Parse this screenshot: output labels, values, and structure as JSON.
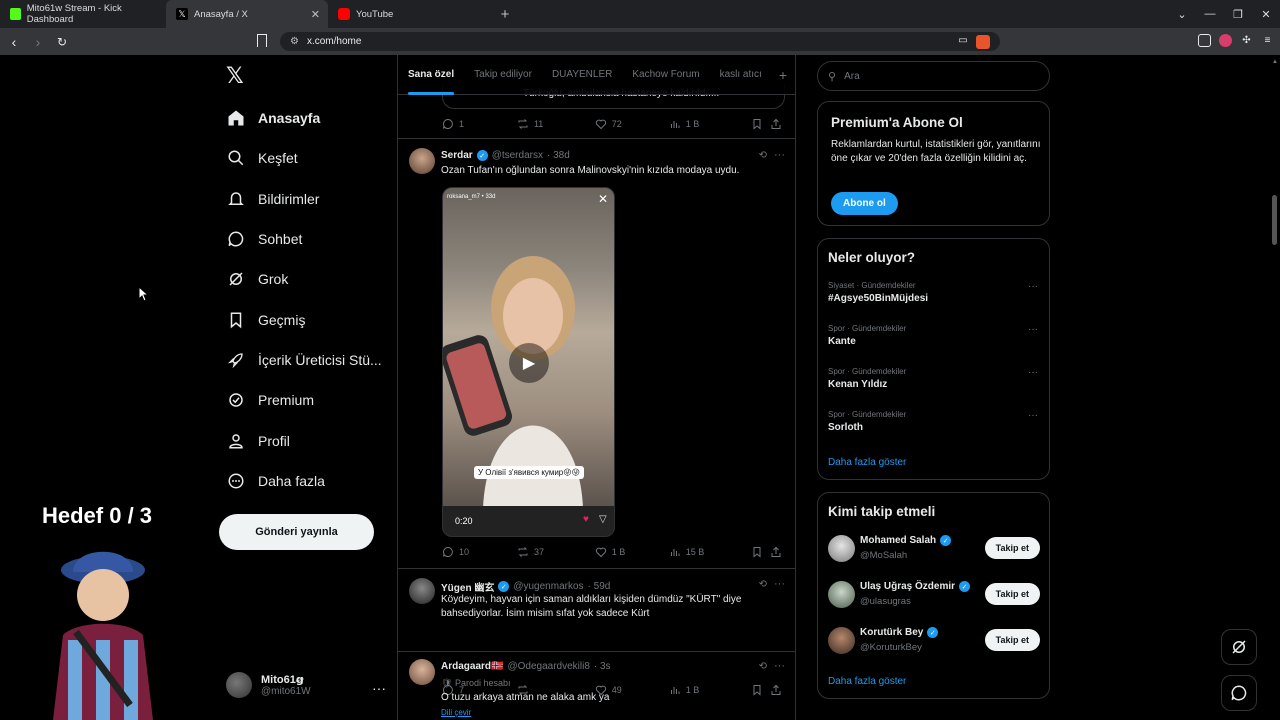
{
  "browser": {
    "tabs": [
      {
        "label": "Mito61w Stream - Kick Dashboard",
        "color": "#53fc18"
      },
      {
        "label": "Anasayfa / X",
        "color": "#ffffff"
      },
      {
        "label": "YouTube",
        "color": "#ff0000"
      }
    ],
    "url": "x.com/home"
  },
  "nav": {
    "items": [
      {
        "label": "Anasayfa",
        "icon": "home-icon"
      },
      {
        "label": "Keşfet",
        "icon": "search-icon"
      },
      {
        "label": "Bildirimler",
        "icon": "bell-icon"
      },
      {
        "label": "Sohbet",
        "icon": "chat-icon"
      },
      {
        "label": "Grok",
        "icon": "grok-icon"
      },
      {
        "label": "Geçmiş",
        "icon": "bookmark-icon"
      },
      {
        "label": "İçerik Üreticisi Stü...",
        "icon": "rocket-icon"
      },
      {
        "label": "Premium",
        "icon": "premium-icon"
      },
      {
        "label": "Profil",
        "icon": "profile-icon"
      },
      {
        "label": "Daha fazla",
        "icon": "more-icon"
      }
    ],
    "post_button": "Gönderi yayınla",
    "account": {
      "name": "Mito61ꞡ",
      "handle": "@mito61W"
    }
  },
  "overlay": {
    "goal": "Hedef 0 / 3"
  },
  "feed": {
    "tabs": [
      "Sana özel",
      "Takip ediliyor",
      "DUAYENLER",
      "Kachow Forum",
      "kaslı atıcı"
    ],
    "snippet_text": "Türkoğlu, ambulansla hastaneye kaldırıldı....",
    "top_actions": {
      "replies": "1",
      "reposts": "11",
      "likes": "72",
      "views": "1 B"
    },
    "posts": [
      {
        "name": "Serdar",
        "handle": "@tserdarsx",
        "time": "· 38d",
        "text": "Ozan Tufan'ın oğlundan sonra Malinovskyi'nin kızıda modaya uydu.",
        "video_duration": "0:20",
        "video_caption": "У Олівії з'явився кумир😜😜",
        "video_user": "roksana_m7 • 33d",
        "actions": {
          "replies": "10",
          "reposts": "37",
          "likes": "1 B",
          "views": "15 B"
        }
      },
      {
        "name": "Yügen 幽玄",
        "handle": "@yugenmarkos",
        "time": "· 59d",
        "text": "Köydeyim, hayvan için saman aldıkları kişiden dümdüz \"KÜRT\" diye bahsediyorlar. İsim misim sıfat yok sadece Kürt",
        "actions": {
          "replies": "7",
          "reposts": "",
          "likes": "49",
          "views": "1 B"
        }
      },
      {
        "name": "Ardagaard🇳🇴",
        "handle": "@Odegaardvekili8",
        "time": "· 3s",
        "parody": "Parodi hesabı",
        "text": "O tuzu arkaya atman ne alaka amk ya",
        "translate": "Dili çevir"
      }
    ]
  },
  "sidebar_right": {
    "search_placeholder": "Ara",
    "premium": {
      "title": "Premium'a Abone Ol",
      "text": "Reklamlardan kurtul, istatistikleri gör, yanıtlarını öne çıkar ve 20'den fazla özelliğin kilidini aç.",
      "button": "Abone ol"
    },
    "trends": {
      "title": "Neler oluyor?",
      "items": [
        {
          "meta": "Siyaset · Gündemdekiler",
          "topic": "#Agsye50BinMüjdesi"
        },
        {
          "meta": "Spor · Gündemdekiler",
          "topic": "Kante"
        },
        {
          "meta": "Spor · Gündemdekiler",
          "topic": "Kenan Yıldız"
        },
        {
          "meta": "Spor · Gündemdekiler",
          "topic": "Sorloth"
        }
      ],
      "more": "Daha fazla göster"
    },
    "who_to_follow": {
      "title": "Kimi takip etmeli",
      "items": [
        {
          "name": "Mohamed Salah",
          "handle": "@MoSalah",
          "button": "Takip et"
        },
        {
          "name": "Ulaş Uğraş Özdemir",
          "handle": "@ulasugras",
          "button": "Takip et"
        },
        {
          "name": "Korutürk Bey",
          "handle": "@KoruturkBey",
          "button": "Takip et"
        }
      ],
      "more": "Daha fazla göster"
    }
  }
}
